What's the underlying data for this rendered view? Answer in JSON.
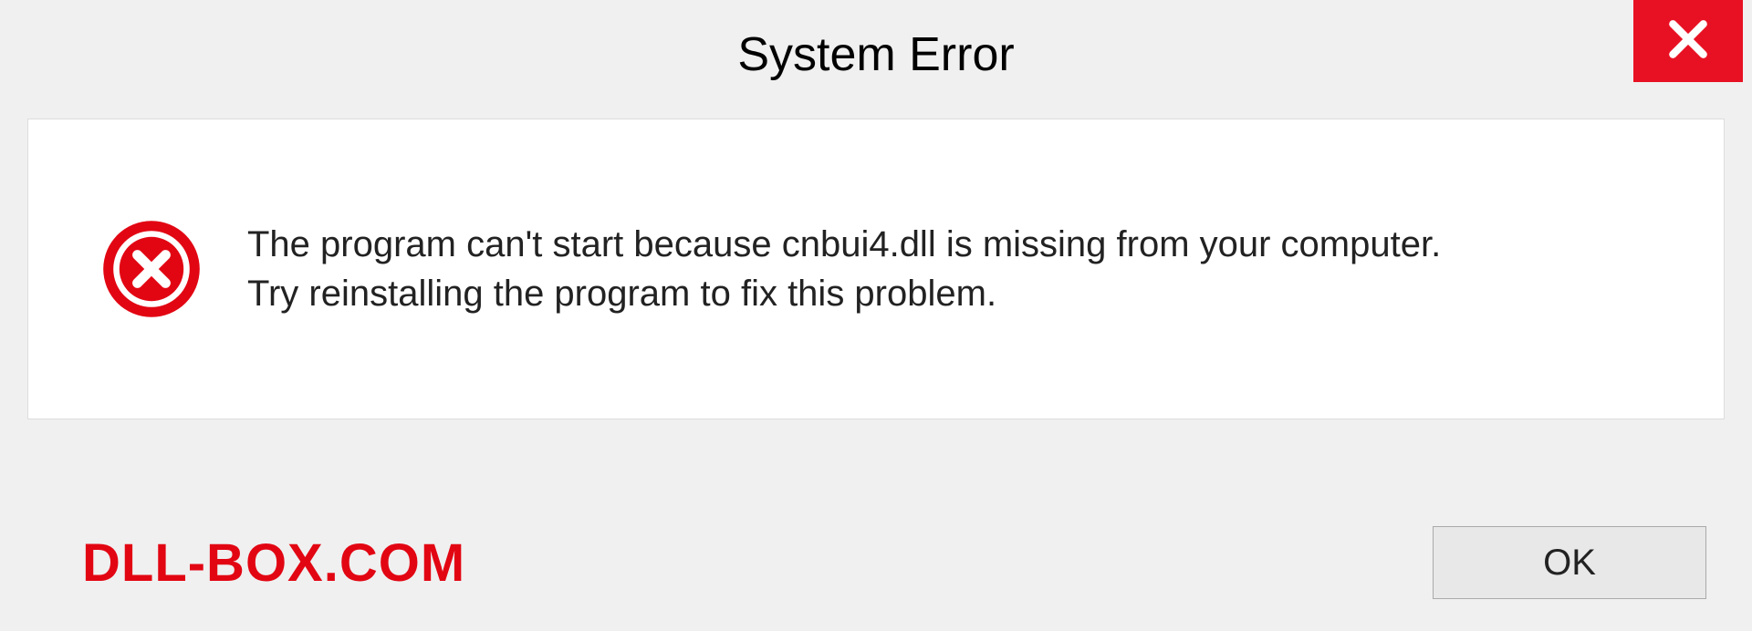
{
  "titlebar": {
    "title": "System Error"
  },
  "message": {
    "line1": "The program can't start because cnbui4.dll is missing from your computer.",
    "line2": "Try reinstalling the program to fix this problem."
  },
  "footer": {
    "watermark": "DLL-BOX.COM",
    "ok_label": "OK"
  },
  "colors": {
    "close_bg": "#e81123",
    "error_red": "#e20613"
  }
}
